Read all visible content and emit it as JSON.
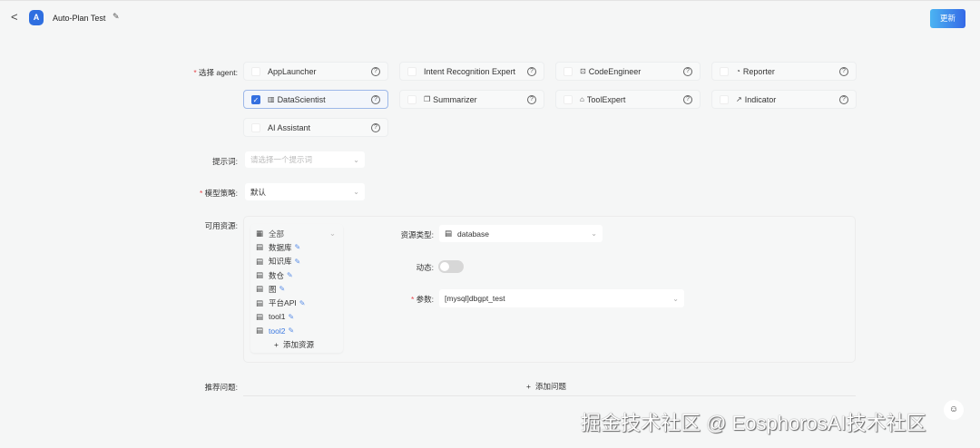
{
  "header": {
    "title": "Auto-Plan Test",
    "update_label": "更新"
  },
  "form": {
    "agent_label": "选择 agent",
    "agents": [
      {
        "name": "AppLauncher",
        "icon": "",
        "checked": false
      },
      {
        "name": "Intent Recognition Expert",
        "icon": "",
        "checked": false
      },
      {
        "name": "CodeEngineer",
        "icon": "⊡",
        "checked": false
      },
      {
        "name": "Reporter",
        "icon": "◔",
        "checked": false
      },
      {
        "name": "DataScientist",
        "icon": "▥",
        "checked": true
      },
      {
        "name": "Summarizer",
        "icon": "❐",
        "checked": false
      },
      {
        "name": "ToolExpert",
        "icon": "⌂",
        "checked": false
      },
      {
        "name": "Indicator",
        "icon": "↗",
        "checked": false
      },
      {
        "name": "AI Assistant",
        "icon": "",
        "checked": false
      }
    ],
    "prompt_label": "提示词",
    "prompt_placeholder": "请选择一个提示词",
    "model_label": "模型策略",
    "model_value": "默认",
    "resources_label": "可用资源",
    "resources": {
      "all_label": "全部",
      "items": [
        "数据库",
        "知识库",
        "数仓",
        "图",
        "平台API",
        "tool1",
        "tool2"
      ],
      "active_index": 6,
      "add_label": "添加资源"
    },
    "resource_type_label": "资源类型",
    "resource_type_value": "database",
    "dynamic_label": "动态",
    "dynamic_on": false,
    "params_label": "参数",
    "params_value": "[mysql]dbgpt_test",
    "questions_label": "推荐问题",
    "add_question_label": "添加问题"
  },
  "watermark": "掘金技术社区 @ EosphorosAI技术社区"
}
